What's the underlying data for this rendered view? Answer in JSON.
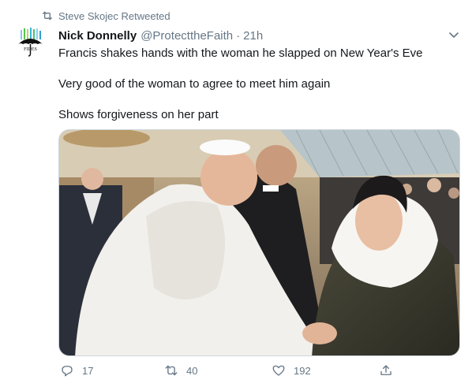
{
  "retweet_banner": {
    "text": "Steve Skojec Retweeted",
    "icon": "retweet-icon"
  },
  "avatar": {
    "label": "FIDES"
  },
  "tweet": {
    "display_name": "Nick Donnelly",
    "handle": "@ProtecttheFaith",
    "separator": "·",
    "time": "21h",
    "lines": [
      "Francis shakes hands with the woman he slapped on New Year's Eve",
      "Very good of the woman to agree to meet him again",
      "Shows forgiveness on her part"
    ]
  },
  "actions": {
    "reply_count": "17",
    "retweet_count": "40",
    "like_count": "192"
  },
  "colors": {
    "text": "#14171a",
    "secondary": "#657786",
    "border": "#ccd6dd"
  }
}
